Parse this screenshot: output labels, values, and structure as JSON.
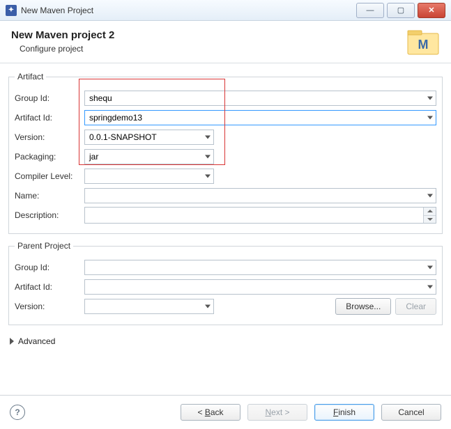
{
  "window": {
    "title": "New Maven Project"
  },
  "header": {
    "title": "New Maven project 2",
    "subtitle": "Configure project",
    "icon_name": "maven-logo"
  },
  "artifact": {
    "legend": "Artifact",
    "group_id_label": "Group Id:",
    "group_id_value": "shequ",
    "artifact_id_label": "Artifact Id:",
    "artifact_id_value": "springdemo13",
    "version_label": "Version:",
    "version_value": "0.0.1-SNAPSHOT",
    "packaging_label": "Packaging:",
    "packaging_value": "jar",
    "compiler_label": "Compiler Level:",
    "compiler_value": "",
    "name_label": "Name:",
    "name_value": "",
    "description_label": "Description:",
    "description_value": ""
  },
  "parent": {
    "legend": "Parent Project",
    "group_id_label": "Group Id:",
    "group_id_value": "",
    "artifact_id_label": "Artifact Id:",
    "artifact_id_value": "",
    "version_label": "Version:",
    "version_value": "",
    "browse_label": "Browse...",
    "clear_label": "Clear"
  },
  "advanced_label": "Advanced",
  "footer": {
    "back_label": "Back",
    "next_label": "Next",
    "finish_label": "Finish",
    "cancel_label": "Cancel"
  }
}
